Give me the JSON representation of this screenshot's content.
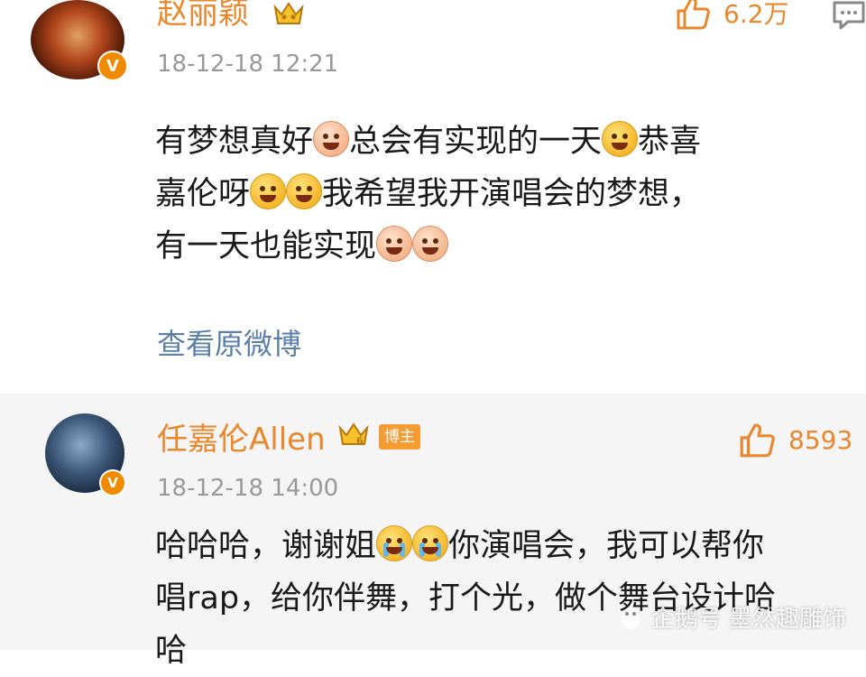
{
  "comments": [
    {
      "name": "赵丽颖",
      "timestamp": "18-12-18 12:21",
      "likes": "6.2万",
      "lines": [
        [
          "有梦想真好",
          "{pink}",
          "总会有实现的一天",
          "{yellow}",
          "恭喜"
        ],
        [
          "嘉伦呀",
          "{yellow}",
          "{yellow}",
          "我希望我开演唱会的梦想，"
        ],
        [
          "有一天也能实现",
          "{pink}",
          "{pink}"
        ]
      ],
      "view_original": "查看原微博"
    },
    {
      "name": "任嘉伦Allen",
      "tag": "博主",
      "timestamp": "18-12-18 14:00",
      "likes": "8593",
      "line1": "哈哈哈，谢谢姐",
      "line1b": "你演唱会，我可以帮你",
      "line2": "唱rap，给你伴舞，打个光，做个舞台设计哈",
      "line3": "哈"
    }
  ],
  "watermark": "企鹅号 墨然趣雕饰",
  "colors": {
    "name": "#e8872c",
    "link": "#5b7fa8",
    "timestamp": "#999999",
    "vip": "#f08a00"
  }
}
